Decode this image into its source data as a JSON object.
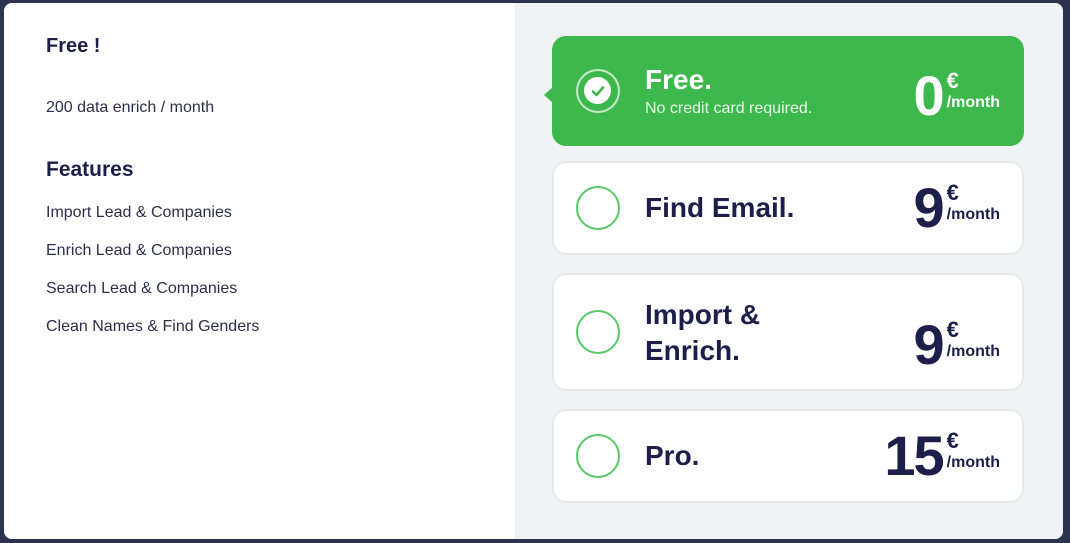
{
  "details": {
    "title": "Free !",
    "description": "200 data enrich / month",
    "features_title": "Features",
    "features": [
      "Import Lead & Companies",
      "Enrich  Lead & Companies",
      "Search  Lead & Companies",
      "Clean Names & Find Genders"
    ]
  },
  "plans": [
    {
      "name": "Free.",
      "subtitle": "No credit card required.",
      "amount": "0",
      "currency": "€",
      "period": "/month",
      "selected": true
    },
    {
      "name": "Find Email.",
      "amount": "9",
      "currency": "€",
      "period": "/month",
      "selected": false
    },
    {
      "name": "Import &",
      "name2": "Enrich.",
      "amount": "9",
      "currency": "€",
      "period": "/month",
      "selected": false
    },
    {
      "name": "Pro.",
      "amount": "15",
      "currency": "€",
      "period": "/month",
      "selected": false
    }
  ],
  "colors": {
    "accent": "#3db84c",
    "text": "#1b1f4a",
    "panel": "#f1f2f4"
  },
  "icons": {
    "selected": "check-icon"
  }
}
